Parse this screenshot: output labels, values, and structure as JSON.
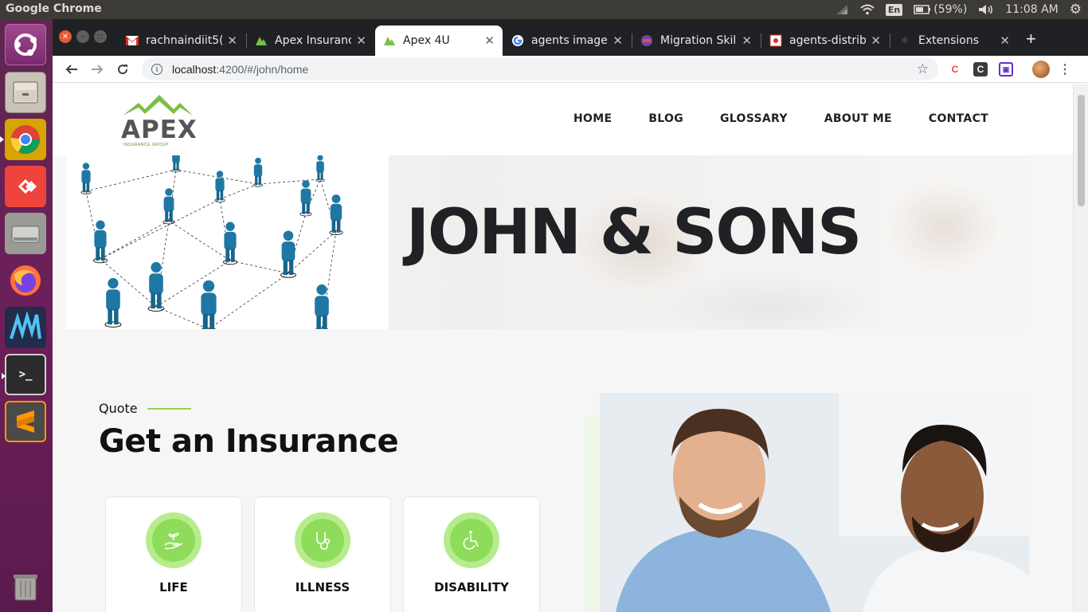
{
  "system": {
    "app_title": "Google Chrome",
    "language": "En",
    "battery": "(59%)",
    "clock": "11:08 AM"
  },
  "launcher": {
    "items": [
      "ubuntu-dash",
      "files",
      "chrome",
      "anydesk",
      "disk",
      "firefox",
      "app",
      "terminal",
      "sublime-text",
      "trash"
    ]
  },
  "browser": {
    "tabs": [
      {
        "label": "rachnaindiit5(",
        "favicon": "gmail-icon"
      },
      {
        "label": "Apex Insuranc",
        "favicon": "apex-icon"
      },
      {
        "label": "Apex 4U",
        "favicon": "apex-icon",
        "active": true
      },
      {
        "label": "agents images",
        "favicon": "google-icon"
      },
      {
        "label": "Migration Skil",
        "favicon": "migration-icon"
      },
      {
        "label": "agents-distrib",
        "favicon": "image-icon"
      },
      {
        "label": "Extensions",
        "favicon": "puzzle-icon"
      }
    ],
    "url_host": "localhost",
    "url_path": ":4200/#/john/home"
  },
  "site": {
    "logo_text": "APEX",
    "logo_sub": "INSURANCE GROUP",
    "nav": [
      "HOME",
      "BLOG",
      "GLOSSARY",
      "ABOUT ME",
      "CONTACT"
    ],
    "hero_title": "JOHN & SONS",
    "eyebrow": "Quote",
    "section_title": "Get an Insurance",
    "cards": [
      {
        "label": "LIFE",
        "icon": "hand-plant-icon"
      },
      {
        "label": "ILLNESS",
        "icon": "stethoscope-icon"
      },
      {
        "label": "DISABILITY",
        "icon": "wheelchair-icon"
      }
    ],
    "accent_color": "#8edc5a"
  }
}
